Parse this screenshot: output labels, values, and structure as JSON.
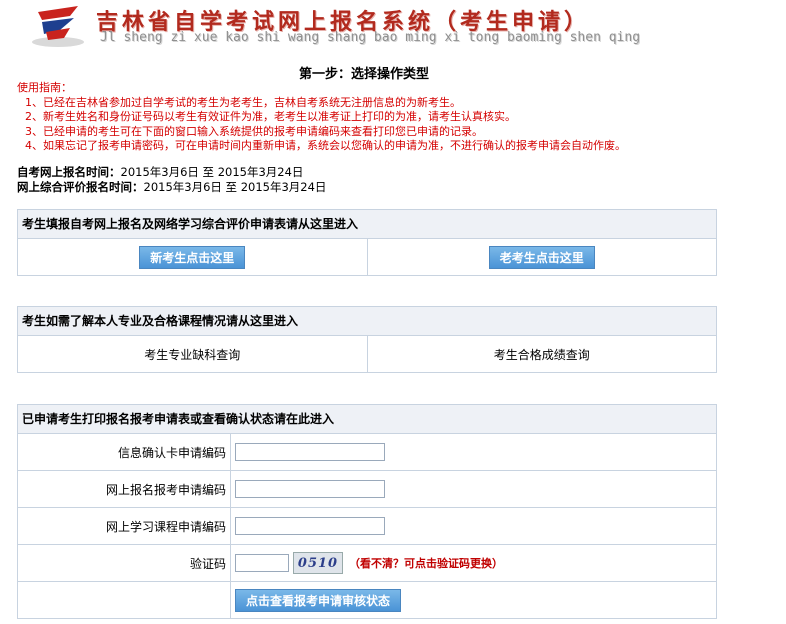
{
  "header": {
    "title": "吉林省自学考试网上报名系统（考生申请）",
    "subtitle": "Jl sheng zi xue kao shi wang shang bao ming xi tong baoming shen qing"
  },
  "step_title": "第一步：选择操作类型",
  "guide": {
    "heading": "使用指南：",
    "items": [
      "1、已经在吉林省参加过自学考试的考生为老考生，吉林自考系统无注册信息的为新考生。",
      "2、新考生姓名和身份证号码以考生有效证件为准，老考生以准考证上打印的为准，请考生认真核实。",
      "3、已经申请的考生可在下面的窗口输入系统提供的报考申请编码来查看打印您已申请的记录。",
      "4、如果忘记了报考申请密码，可在申请时间内重新申请，系统会以您确认的申请为准，不进行确认的报考申请会自动作废。"
    ]
  },
  "times": {
    "online_label": "自考网上报名时间：",
    "online_value": "2015年3月6日 至 2015年3月24日",
    "eval_label": "网上综合评价报名时间：",
    "eval_value": "2015年3月6日 至 2015年3月24日"
  },
  "section1": {
    "heading": "考生填报自考网上报名及网络学习综合评价申请表请从这里进入",
    "new_button": "新考生点击这里",
    "old_button": "老考生点击这里"
  },
  "section2": {
    "heading": "考生如需了解本人专业及合格课程情况请从这里进入",
    "link1": "考生专业缺科查询",
    "link2": "考生合格成绩查询"
  },
  "section3": {
    "heading": "已申请考生打印报名报考申请表或查看确认状态请在此进入",
    "field1_label": "信息确认卡申请编码",
    "field2_label": "网上报名报考申请编码",
    "field3_label": "网上学习课程申请编码",
    "captcha_label": "验证码",
    "captcha_text": "0510",
    "captcha_hint": "（看不清？可点击验证码更换）",
    "submit": "点击查看报考申请审核状态"
  }
}
